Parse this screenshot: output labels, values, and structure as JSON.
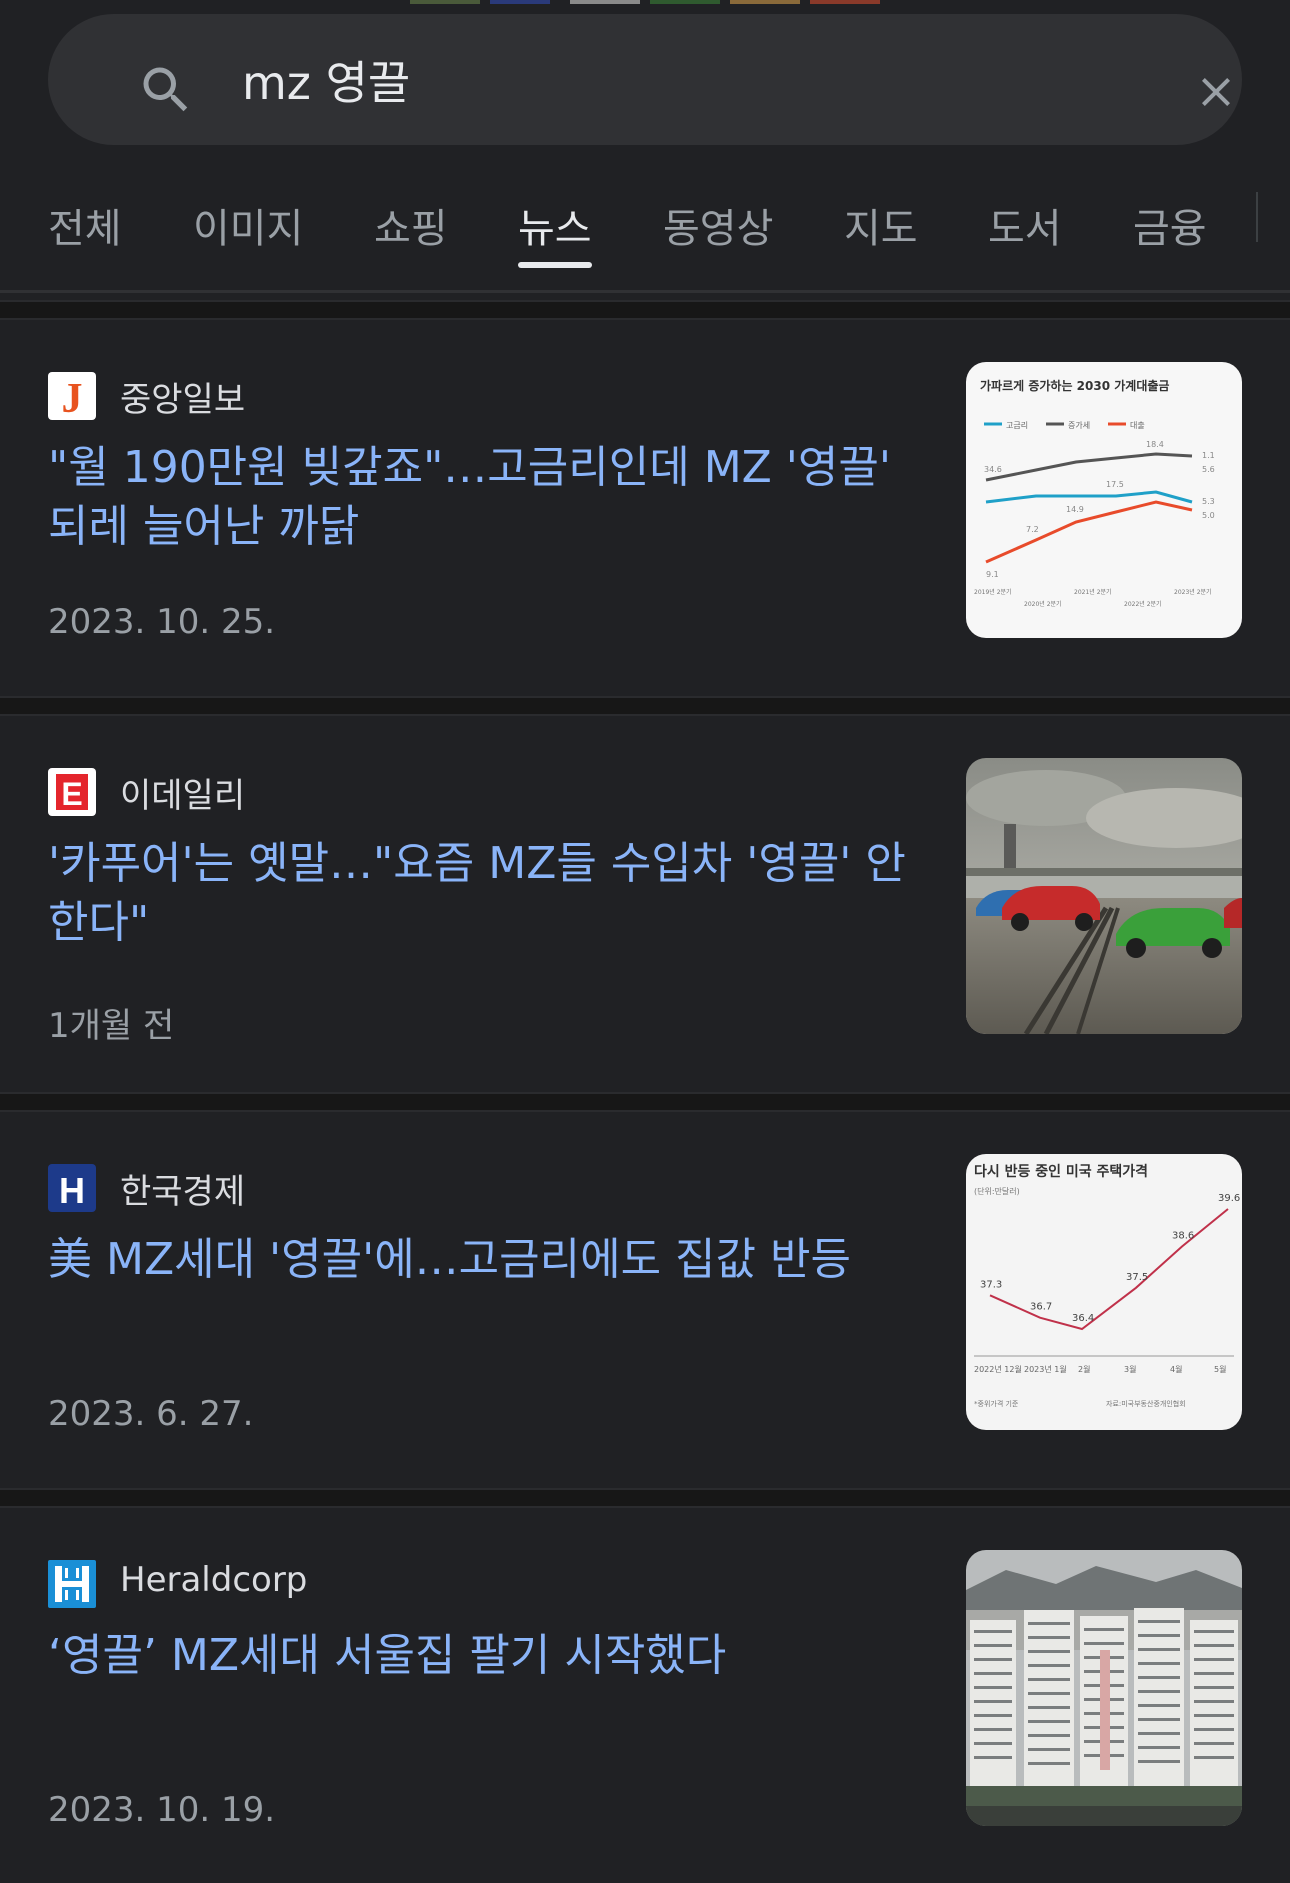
{
  "search": {
    "query": "mz 영끌"
  },
  "tabs": [
    {
      "label": "전체"
    },
    {
      "label": "이미지"
    },
    {
      "label": "쇼핑"
    },
    {
      "label": "뉴스",
      "active": true
    },
    {
      "label": "동영상"
    },
    {
      "label": "지도"
    },
    {
      "label": "도서"
    },
    {
      "label": "금융"
    }
  ],
  "results": [
    {
      "source": "중앙일보",
      "logo_letter": "J",
      "logo_color": "#e8531f",
      "title": "\"월 190만원 빚갚죠\"…고금리인데 MZ '영끌' 되레 늘어난 까닭",
      "date": "2023. 10. 25.",
      "thumb": {
        "title": "가파르게 증가하는 2030 가계대출금",
        "legend": [
          "고금리",
          "증가세",
          "대출"
        ],
        "labels": [
          "34.6",
          "7.2",
          "14.9",
          "17.5",
          "18.4",
          "9.1",
          "1.1"
        ],
        "right_labels": [
          "5.6",
          "5.3",
          "5.0"
        ],
        "xticks": [
          "2019년 2분기",
          "2020년 2분기",
          "2021년 2분기",
          "2022년 2분기",
          "2023년 2분기"
        ]
      }
    },
    {
      "source": "이데일리",
      "logo_letter": "E",
      "logo_color": "#e4252c",
      "title": "'카푸어'는 옛말…\"요즘 MZ들 수입차 '영끌' 안 한다\"",
      "date": "1개월 전",
      "thumb": {}
    },
    {
      "source": "한국경제",
      "logo_letter": "H",
      "logo_color": "#1d3a8a",
      "title": "美 MZ세대 '영끌'에…고금리에도 집값 반등",
      "date": "2023. 6. 27.",
      "thumb": {
        "title": "다시 반등 중인 미국 주택가격",
        "unit": "(단위:만달러)",
        "values": [
          37.3,
          36.7,
          36.4,
          37.5,
          38.6,
          39.6
        ],
        "xticks": [
          "2022년 12월",
          "2023년 1월",
          "2월",
          "3월",
          "4월",
          "5월"
        ],
        "footnote": "*중위가격 기준",
        "source": "자료:미국부동산중개인협회"
      }
    },
    {
      "source": "Heraldcorp",
      "logo_letter": "H",
      "logo_color": "#1a8fd6",
      "title": "‘영끌’ MZ세대 서울집 팔기 시작했다",
      "date": "2023. 10. 19.",
      "thumb": {}
    }
  ]
}
